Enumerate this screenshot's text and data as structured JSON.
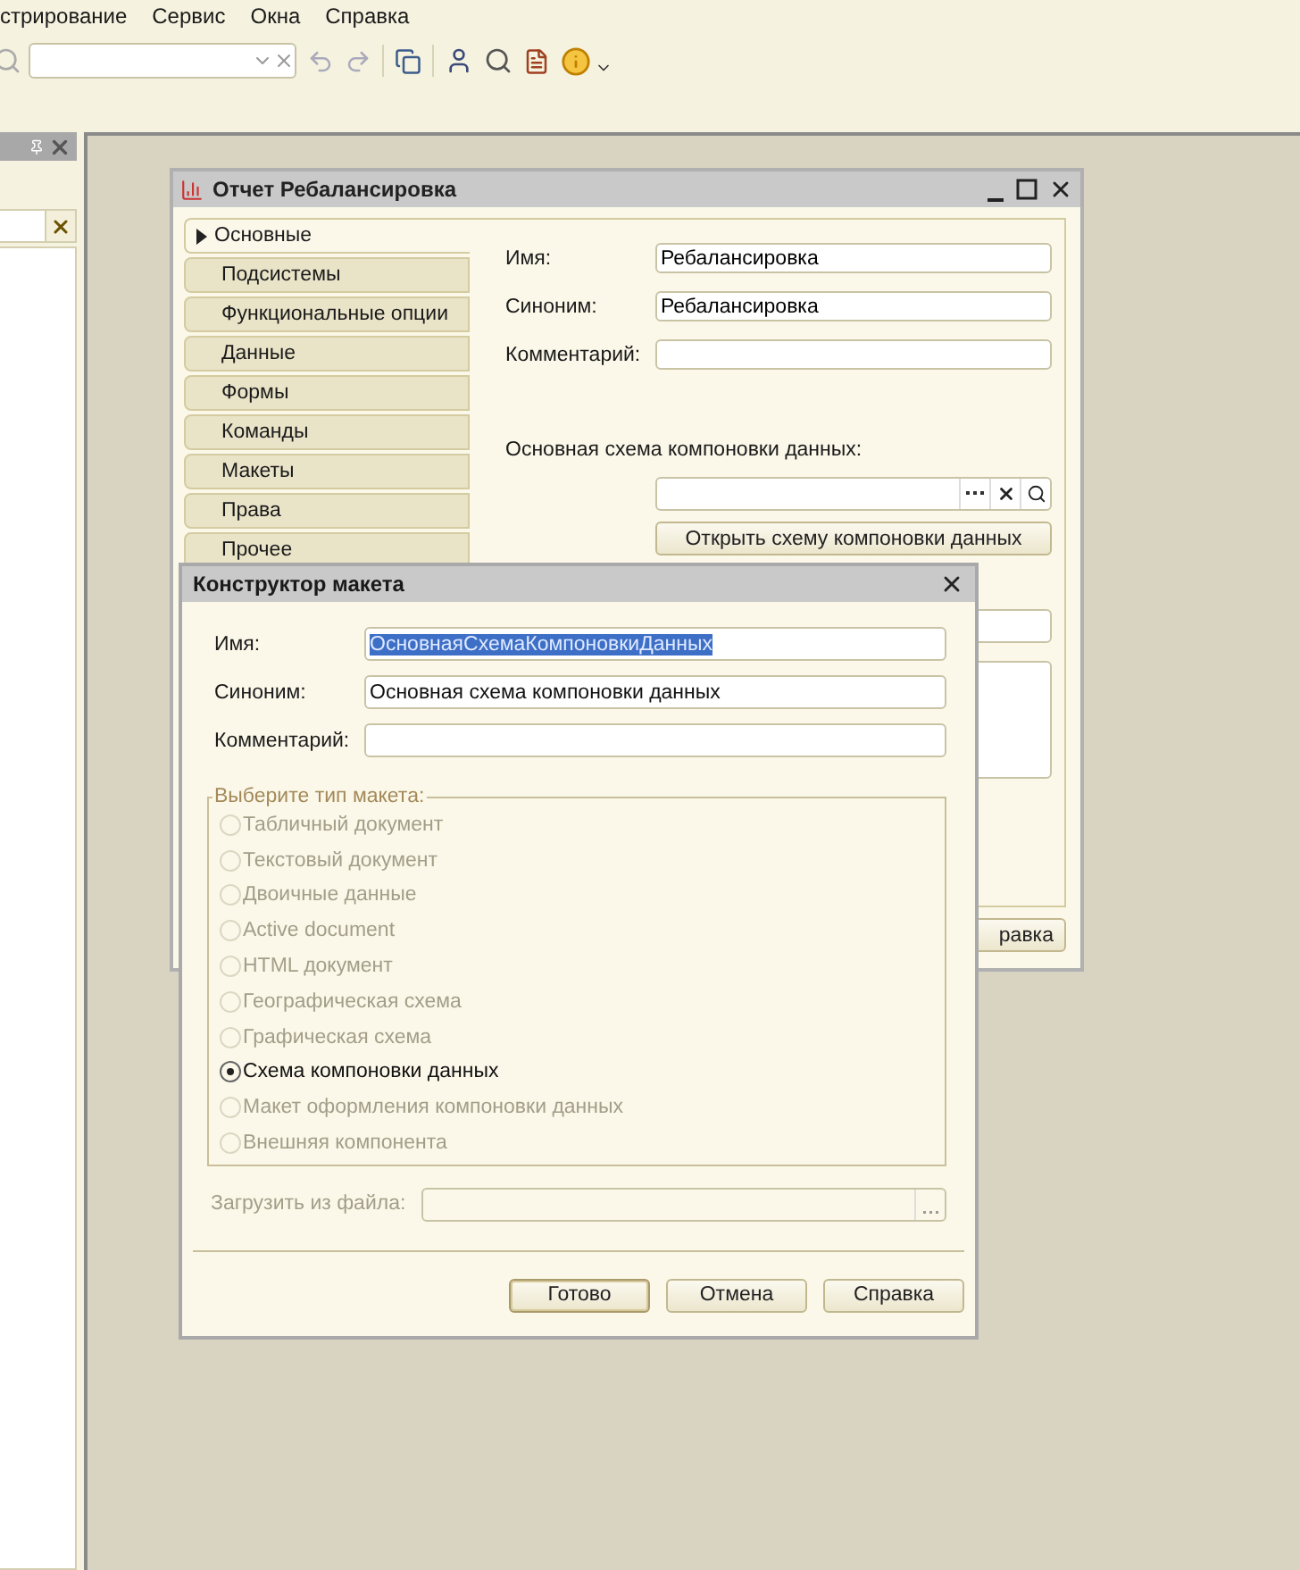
{
  "menu": [
    "стрирование",
    "Сервис",
    "Окна",
    "Справка"
  ],
  "report_window": {
    "title": "Отчет Ребалансировка",
    "tabs": [
      {
        "label": "Основные",
        "selected": true
      },
      {
        "label": "Подсистемы",
        "selected": false
      },
      {
        "label": "Функциональные опции",
        "selected": false
      },
      {
        "label": "Данные",
        "selected": false
      },
      {
        "label": "Формы",
        "selected": false
      },
      {
        "label": "Команды",
        "selected": false
      },
      {
        "label": "Макеты",
        "selected": false
      },
      {
        "label": "Права",
        "selected": false
      },
      {
        "label": "Прочее",
        "selected": false
      }
    ],
    "fields": [
      {
        "label": "Имя:",
        "value": "Ребалансировка"
      },
      {
        "label": "Синоним:",
        "value": "Ребалансировка"
      },
      {
        "label": "Комментарий:"
      }
    ],
    "schema_label": "Основная схема компоновки данных:",
    "open_schema_button": "Открыть схему компоновки данных",
    "help_button": "равка"
  },
  "dialog": {
    "title": "Конструктор макета",
    "fields": [
      {
        "label": "Имя:",
        "value": "ОсновнаяСхемаКомпоновкиДанных",
        "highlighted": true
      },
      {
        "label": "Синоним:",
        "value": "Основная схема компоновки данных",
        "highlighted": false
      },
      {
        "label": "Комментарий:",
        "highlighted": false
      }
    ],
    "group_title": "Выберите тип макета:",
    "options": [
      {
        "label": "Табличный документ",
        "selected": false,
        "disabled": true
      },
      {
        "label": "Текстовый документ",
        "selected": false,
        "disabled": true
      },
      {
        "label": "Двоичные данные",
        "selected": false,
        "disabled": true
      },
      {
        "label": "Active document",
        "selected": false,
        "disabled": true
      },
      {
        "label": "HTML документ",
        "selected": false,
        "disabled": true
      },
      {
        "label": "Географическая схема",
        "selected": false,
        "disabled": true
      },
      {
        "label": "Графическая схема",
        "selected": false,
        "disabled": true
      },
      {
        "label": "Схема компоновки данных",
        "selected": true,
        "disabled": false
      },
      {
        "label": "Макет оформления компоновки данных",
        "selected": false,
        "disabled": true
      },
      {
        "label": "Внешняя компонента",
        "selected": false,
        "disabled": true
      }
    ],
    "load_label": "Загрузить из файла:",
    "buttons": [
      {
        "label": "Готово",
        "default": true
      },
      {
        "label": "Отмена",
        "default": false
      },
      {
        "label": "Справка",
        "default": false
      }
    ]
  }
}
